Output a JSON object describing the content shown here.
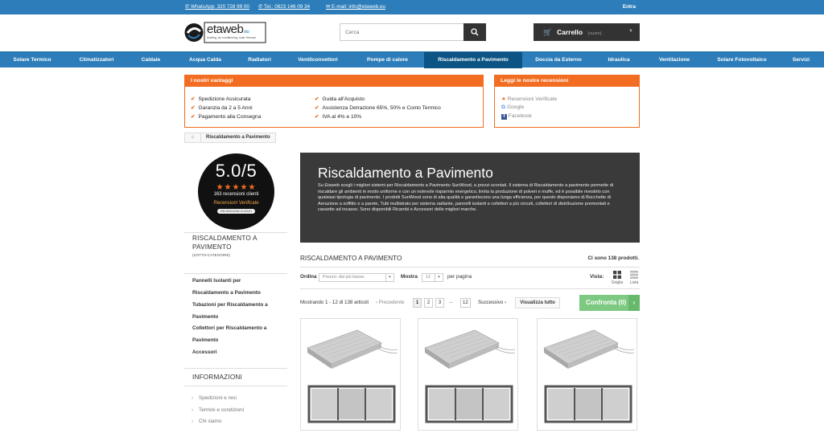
{
  "topbar": {
    "whatsapp": "WhatsApp: 320 728 99 00",
    "tel": "Tel.: 0823 146 09 34",
    "email": "E-mail: info@etaweb.eu",
    "login": "Entra"
  },
  "brand": {
    "name": "etaweb",
    "suffix": ".eu",
    "tagline": "heating, air conditioning, solar thermal"
  },
  "search": {
    "placeholder": "Cerca"
  },
  "cart": {
    "label": "Carrello",
    "status": "(vuoto)"
  },
  "nav": [
    "Solare Termico",
    "Climatizzatori",
    "Caldaie",
    "Acqua Calda",
    "Radiatori",
    "Ventilconvettori",
    "Pompe di calore",
    "Riscaldamento a Pavimento",
    "Doccia da Esterno",
    "Idraulica",
    "Ventilazione",
    "Solare Fotovoltaico",
    "Servizi"
  ],
  "advantages": {
    "title": "I nostri vantaggi",
    "left": [
      "Spedizione Assicurata",
      "Garanzia da 2 a 5 Anni",
      "Pagamento alla Consegna"
    ],
    "right": [
      "Guida all'Acquisto",
      "Assistenza Detrazione 65%, 50% e Conto Termico",
      "IVA al 4% e 10%"
    ]
  },
  "reviews": {
    "title": "Leggi le nostre recensioni",
    "items": [
      "Recensioni Verificate",
      "Google",
      "Facebook"
    ]
  },
  "breadcrumb": {
    "current": "Riscaldamento a Pavimento"
  },
  "rating": {
    "score": "5.0/5",
    "stars": "★★★★★",
    "count": "163 recensioni clienti",
    "verified": "Recensioni Verificate",
    "badge": "RECENSIONI CLIENTI"
  },
  "sidebar": {
    "category_title": "RISCALDAMENTO A PAVIMENTO",
    "subtitle": "(SOTTO-CATEGORIE)",
    "categories": [
      "Pannelli Isolanti per",
      "Riscaldamento a Pavimento",
      "Tubazioni per Riscaldamento a",
      "Pavimento",
      "Collettori per Riscaldamento a",
      "Pavimento",
      "Accessori"
    ],
    "info_title": "INFORMAZIONI",
    "info_links": [
      "Spedizioni e resi",
      "Termini e condizioni",
      "Chi siamo"
    ]
  },
  "hero": {
    "title": "Riscaldamento a Pavimento",
    "text": "Su Etaweb scegli i migliori sistemi per Riscaldamento a Pavimento SunWood, a prezzi scontati. Il sistema di Riscaldamento a pavimento permette di riscaldare gli ambienti in modo uniforme e con un notevole risparmio energetico, limita la produzione di polveri e muffe, ed è possibile rivestirlo con qualsiasi tipologia di pavimento. I prodotti SunWood sono di alta qualità e garantiscono una lunga efficienza, per questo disponiamo di Bocchette di Aerazione a soffitto e a parete, Tubi multistrato per sistema radiante, pannelli isolanti e collettori a più circuiti, collettori di distribuzione premontati e cassette ad incasso. Sono disponibili Ricambi e Accessori delle migliori marche."
  },
  "listing": {
    "title": "RISCALDAMENTO A PAVIMENTO",
    "count": "Ci sono 138 prodotti.",
    "sort_label": "Ordina",
    "sort_value": "Prezzo: dal più basso",
    "show_label": "Mostra",
    "show_value": "12",
    "per_page": "per pagina",
    "view_label": "Vista:",
    "view_grid": "Griglia",
    "view_list": "Lista",
    "range": "Mostrando 1 - 12 di 138 articoli",
    "prev": "‹ Precedente",
    "pages": [
      "1",
      "2",
      "3",
      "...",
      "12"
    ],
    "next": "Successivo ›",
    "view_all": "Visualizza tutto",
    "compare": "Confronta (0)"
  },
  "colors": {
    "primary": "#2c7db9",
    "nav_active": "#0b5483",
    "accent": "#f26d21",
    "compare": "#7dc981"
  }
}
